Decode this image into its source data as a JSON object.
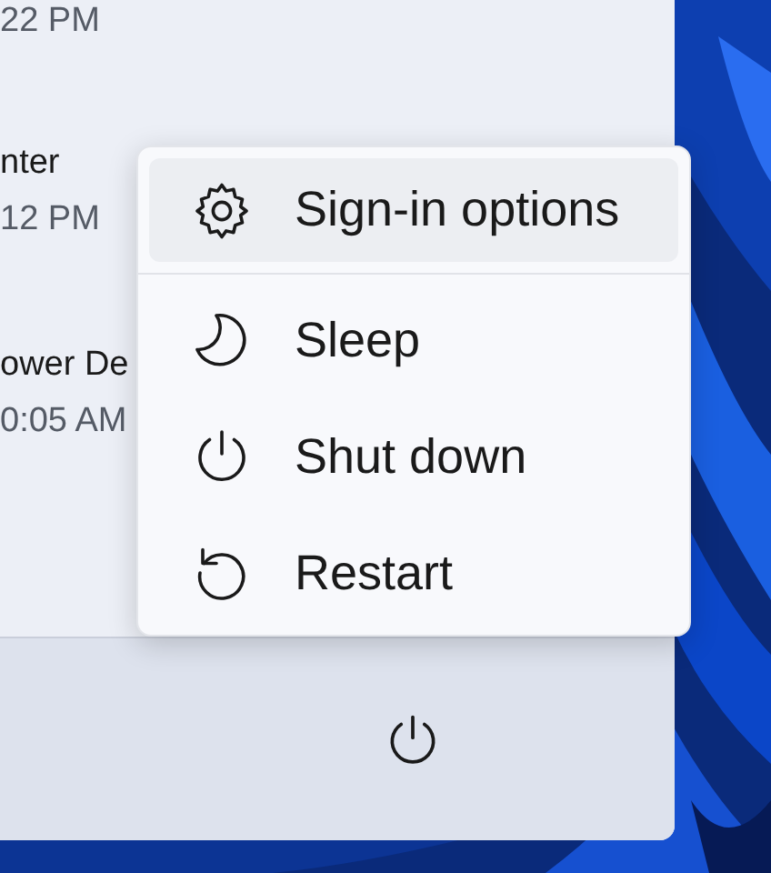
{
  "recent_items": [
    {
      "lines": [
        "22 PM"
      ]
    },
    {
      "lines": [
        "nter",
        "12 PM"
      ]
    },
    {
      "lines": [
        "ower De",
        "0:05 AM"
      ]
    }
  ],
  "power_menu": {
    "items": [
      {
        "label": "Sign-in options",
        "kind": "settings",
        "selected": true,
        "divider_after": true
      },
      {
        "label": "Sleep",
        "kind": "sleep",
        "selected": false,
        "divider_after": false
      },
      {
        "label": "Shut down",
        "kind": "shutdown",
        "selected": false,
        "divider_after": false
      },
      {
        "label": "Restart",
        "kind": "restart",
        "selected": false,
        "divider_after": false
      }
    ]
  }
}
